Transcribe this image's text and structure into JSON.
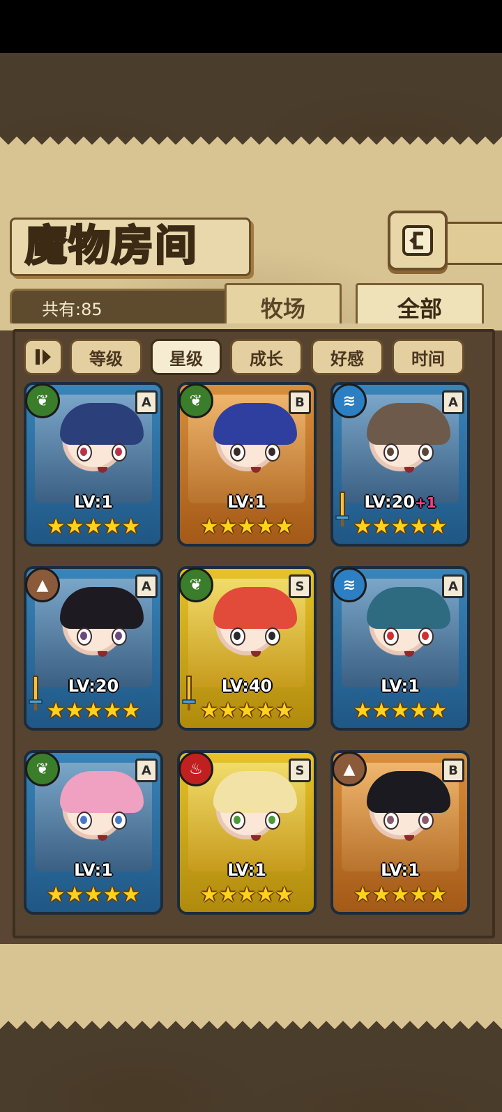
{
  "title": "魔物房间",
  "count_label": "共有:85",
  "tabs": [
    {
      "label": "牧场",
      "active": false
    },
    {
      "label": "全部",
      "active": true
    }
  ],
  "sort_toggle_icon": "sort-order-icon",
  "sort_buttons": [
    {
      "label": "等级",
      "active": false
    },
    {
      "label": "星级",
      "active": true
    },
    {
      "label": "成长",
      "active": false
    },
    {
      "label": "好感",
      "active": false
    },
    {
      "label": "时间",
      "active": false
    }
  ],
  "cards": [
    {
      "element": "nature",
      "rank": "A",
      "level": "LV:1",
      "plus": "",
      "stars": "★★★★★",
      "weapon": false,
      "hair": "#2b3f7a",
      "eye": "#b8334a"
    },
    {
      "element": "nature",
      "rank": "B",
      "level": "LV:1",
      "plus": "",
      "stars": "★★★★★",
      "weapon": false,
      "hair": "#2f3fa0",
      "eye": "#3a2a2a"
    },
    {
      "element": "water",
      "rank": "A",
      "level": "LV:20",
      "plus": "+1",
      "stars": "★★★★★",
      "weapon": true,
      "hair": "#6e5a4a",
      "eye": "#5a4636"
    },
    {
      "element": "earth",
      "rank": "A",
      "level": "LV:20",
      "plus": "",
      "stars": "★★★★★",
      "weapon": true,
      "hair": "#1e1a22",
      "eye": "#6a4a7a"
    },
    {
      "element": "nature",
      "rank": "S",
      "level": "LV:40",
      "plus": "",
      "stars": "★★★★★",
      "weapon": true,
      "hair": "#e24a3a",
      "eye": "#2a2a2a"
    },
    {
      "element": "water",
      "rank": "A",
      "level": "LV:1",
      "plus": "",
      "stars": "★★★★★",
      "weapon": false,
      "hair": "#2e6a80",
      "eye": "#d03030"
    },
    {
      "element": "nature",
      "rank": "A",
      "level": "LV:1",
      "plus": "",
      "stars": "★★★★★",
      "weapon": false,
      "hair": "#f0a0c0",
      "eye": "#4a78c8"
    },
    {
      "element": "fire",
      "rank": "S",
      "level": "LV:1",
      "plus": "",
      "stars": "★★★★★",
      "weapon": false,
      "hair": "#f3e2a6",
      "eye": "#4a9a3a"
    },
    {
      "element": "earth",
      "rank": "B",
      "level": "LV:1",
      "plus": "",
      "stars": "★★★★★",
      "weapon": false,
      "hair": "#1a1a20",
      "eye": "#8a5a6a"
    }
  ]
}
